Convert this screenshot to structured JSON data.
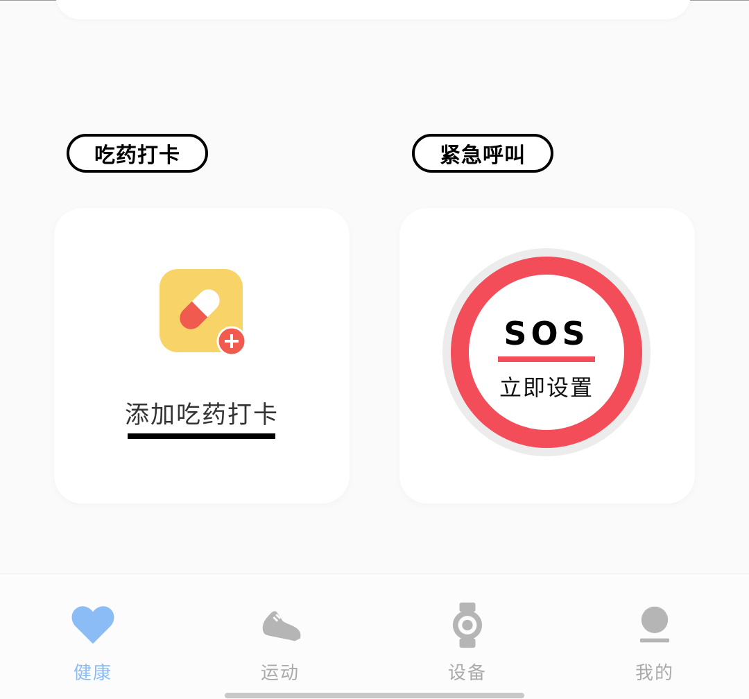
{
  "sections": {
    "medication": {
      "title": "吃药打卡",
      "add_label": "添加吃药打卡"
    },
    "emergency": {
      "title": "紧急呼叫",
      "sos_label": "SOS",
      "sos_action": "立即设置"
    }
  },
  "tabbar": {
    "items": [
      {
        "label": "健康",
        "icon": "heart-icon",
        "active": true
      },
      {
        "label": "运动",
        "icon": "sneaker-icon",
        "active": false
      },
      {
        "label": "设备",
        "icon": "watch-icon",
        "active": false
      },
      {
        "label": "我的",
        "icon": "person-icon",
        "active": false
      }
    ]
  },
  "colors": {
    "accent_blue": "#8bbcf6",
    "sos_red": "#f44d5a",
    "pill_yellow": "#f8d468",
    "inactive_gray": "#aaaaaa"
  }
}
